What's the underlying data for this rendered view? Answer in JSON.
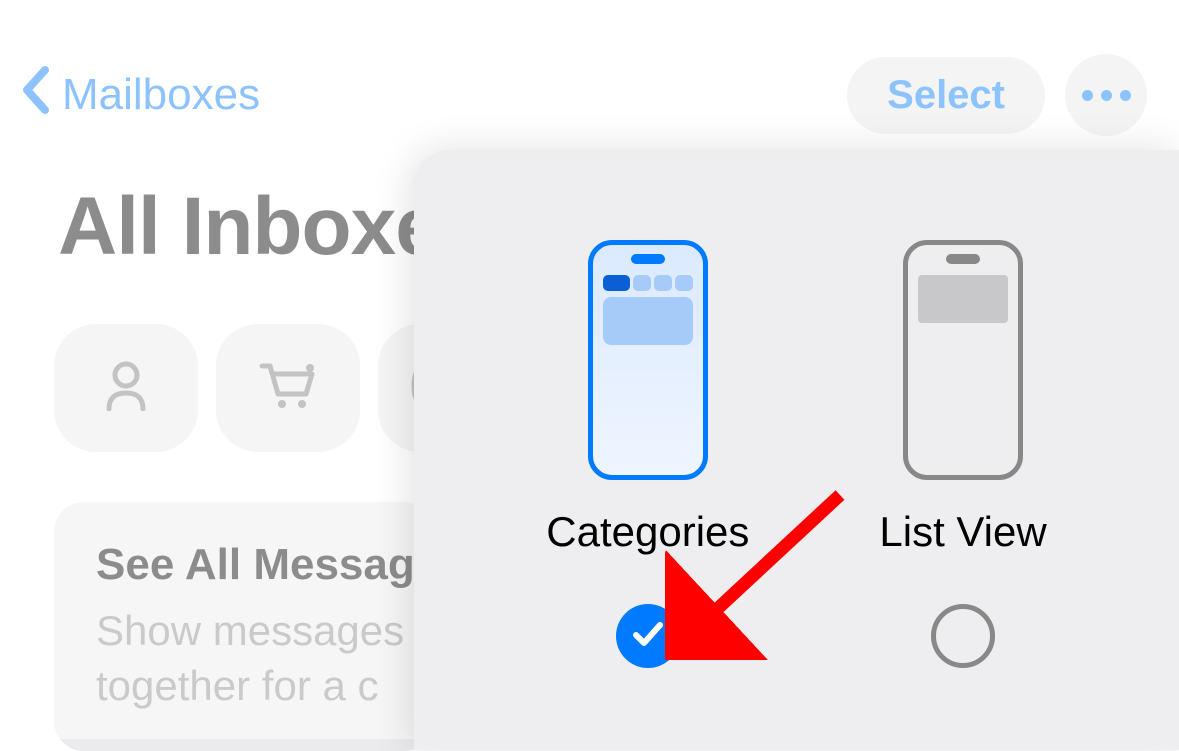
{
  "nav": {
    "back_label": "Mailboxes",
    "select_label": "Select"
  },
  "page": {
    "title": "All Inboxes"
  },
  "info_card": {
    "title": "See All Messages",
    "description_line1": "Show messages",
    "description_line2": "together for a c"
  },
  "popover": {
    "options": {
      "categories": {
        "label": "Categories",
        "selected": true
      },
      "list_view": {
        "label": "List View",
        "selected": false
      }
    }
  },
  "colors": {
    "accent": "#007AFF",
    "secondary_bg": "#e6e6e7",
    "arrow": "#FF0000"
  }
}
